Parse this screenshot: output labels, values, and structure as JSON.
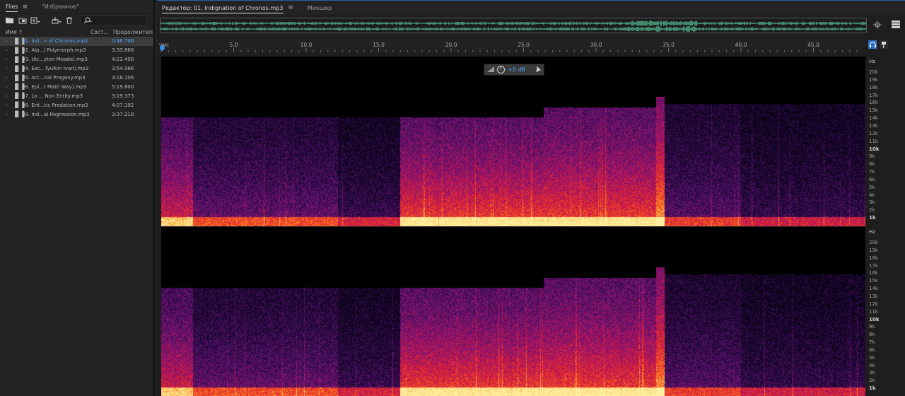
{
  "files_panel": {
    "tabs": [
      {
        "label": "Files",
        "active": true,
        "menu": "≡"
      },
      {
        "label": "\"Избранное\"",
        "active": false
      }
    ],
    "search": {
      "icon": "search-icon",
      "value": ""
    },
    "columns": {
      "name": "Имя ↑",
      "state": "Сост...",
      "duration": "Продолжительн."
    },
    "files": [
      {
        "name": "01. Ind...n of Chronos.mp3",
        "duration": "0:48.746",
        "selected": true
      },
      {
        "name": "02. Alp...l Polymorph.mp3",
        "duration": "3:33.866",
        "selected": false
      },
      {
        "name": "03. Ulc...yton Meade).mp3",
        "duration": "4:22.400",
        "selected": false
      },
      {
        "name": "04. Exc...Tyulkin Ivan).mp3",
        "duration": "3:54.986",
        "selected": false
      },
      {
        "name": "05. Arc...nal Progeny.mp3",
        "duration": "3:18.106",
        "selected": false
      },
      {
        "name": "06. Epi...t Matti Way).mp3",
        "duration": "5:19.800",
        "selected": false
      },
      {
        "name": "07. Lo ... Non Entity.mp3",
        "duration": "3:19.373",
        "selected": false
      },
      {
        "name": "08. Ent...tic Predation.mp3",
        "duration": "4:07.192",
        "selected": false
      },
      {
        "name": "09. Ind...al Regression.mp3",
        "duration": "3:37.218",
        "selected": false
      }
    ]
  },
  "editor": {
    "tabs": [
      {
        "label": "Редактор: 01. Indignation of Chronos.mp3",
        "active": true,
        "menu": "≡"
      },
      {
        "label": "Микшер",
        "active": false
      }
    ],
    "ruler": {
      "unit": "чмс",
      "ticks": [
        "5,0",
        "10,0",
        "15,0",
        "20,0",
        "25,0",
        "30,0",
        "35,0",
        "40,0",
        "45,0"
      ]
    },
    "hud": {
      "gain": "+0 dB"
    },
    "hz_scale": {
      "unit": "Hz",
      "labels": [
        "20k",
        "19k",
        "18k",
        "17k",
        "16k",
        "15k",
        "14k",
        "13k",
        "12k",
        "11k",
        "10k",
        "9k",
        "8k",
        "7k",
        "6k",
        "5k",
        "4k",
        "3k",
        "2k",
        "1k"
      ]
    },
    "accent_color": "#3d8fe6",
    "selection_color": "#4ea4ff"
  }
}
